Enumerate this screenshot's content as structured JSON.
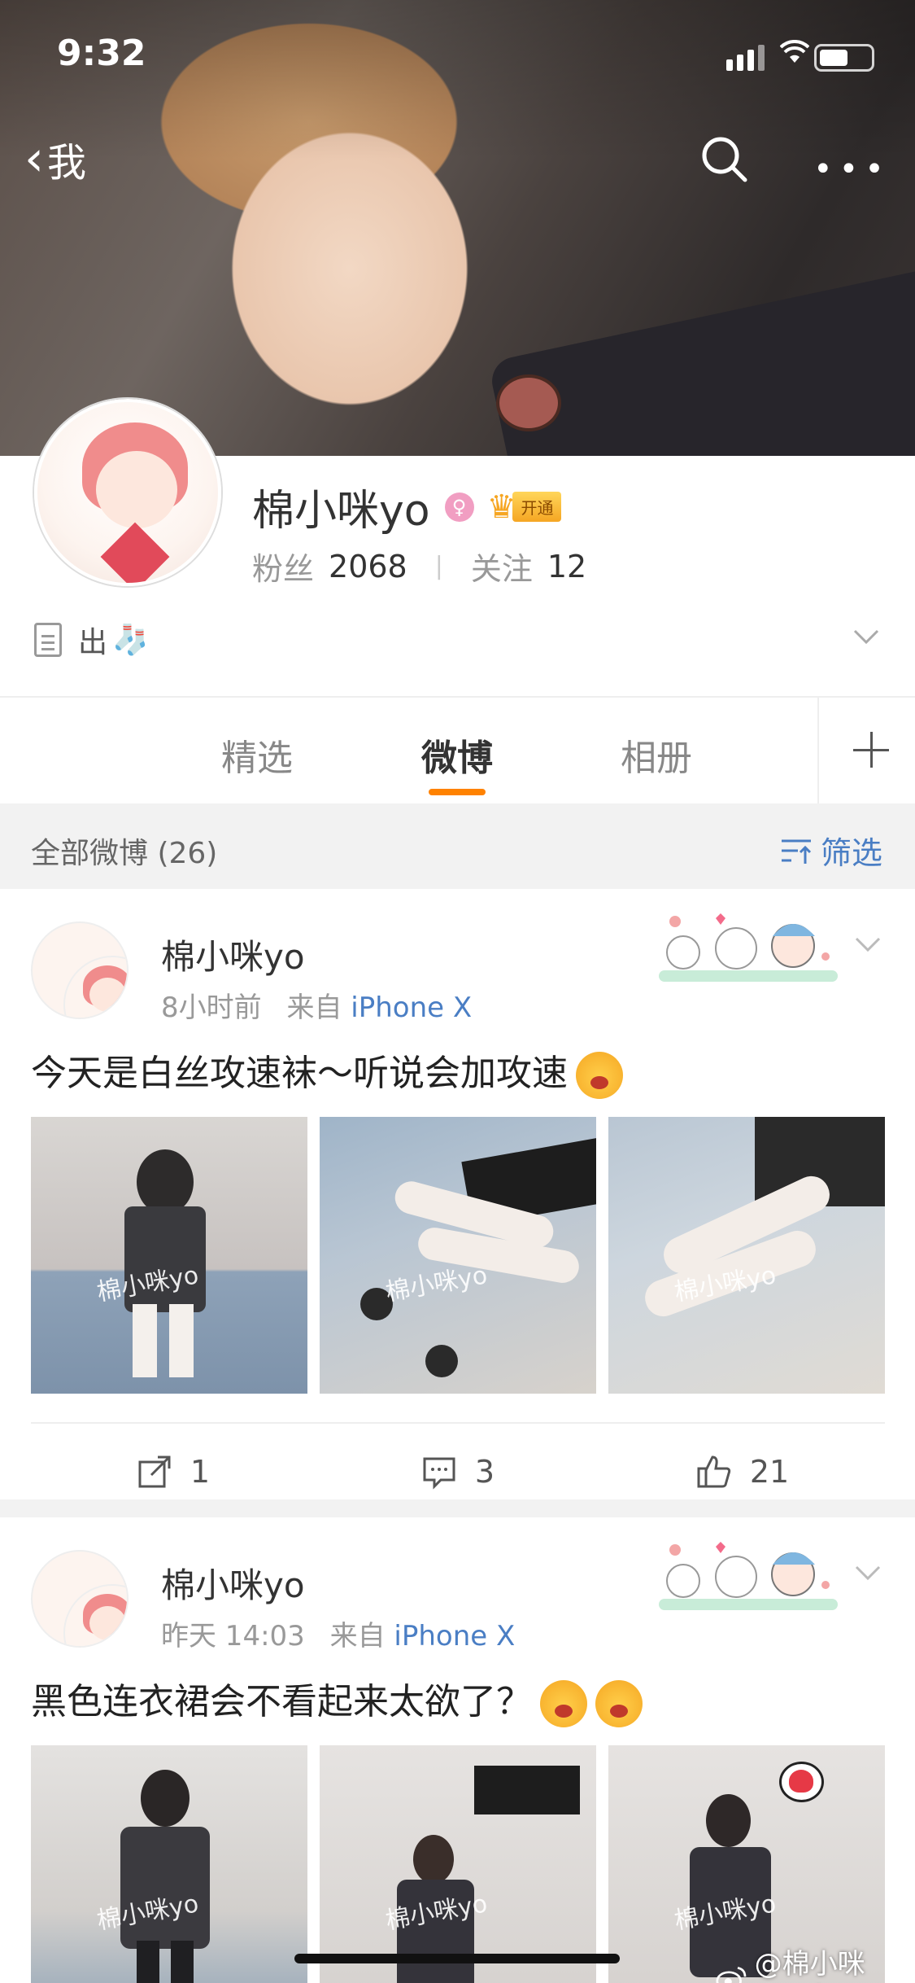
{
  "status_bar": {
    "time": "9:32"
  },
  "nav": {
    "back_label": "我"
  },
  "profile": {
    "name": "棉小咪yo",
    "vip_label": "开通",
    "fans_label": "粉丝",
    "fans_count": "2068",
    "follow_label": "关注",
    "follow_count": "12",
    "intro": "出"
  },
  "tabs": [
    {
      "label": "精选"
    },
    {
      "label": "微博"
    },
    {
      "label": "相册"
    }
  ],
  "filter_bar": {
    "all_label": "全部微博 (26)",
    "filter_label": "筛选"
  },
  "posts": [
    {
      "author": "棉小咪yo",
      "time": "8小时前",
      "source_prefix": "来自",
      "device": "iPhone X",
      "text": "今天是白丝攻速袜～听说会加攻速",
      "photo_watermark": "棉小咪yo",
      "reposts": "1",
      "comments": "3",
      "likes": "21"
    },
    {
      "author": "棉小咪yo",
      "time": "昨天 14:03",
      "source_prefix": "来自",
      "device": "iPhone X",
      "text": "黑色连衣裙会不看起来太欲了？",
      "photo_watermark": "棉小咪yo"
    }
  ],
  "watermark": "@棉小咪yomi",
  "colors": {
    "accent_orange": "#ff8200",
    "link_blue": "#4a7ec4",
    "divider": "#eeeeee",
    "background_gray": "#f2f2f2"
  }
}
